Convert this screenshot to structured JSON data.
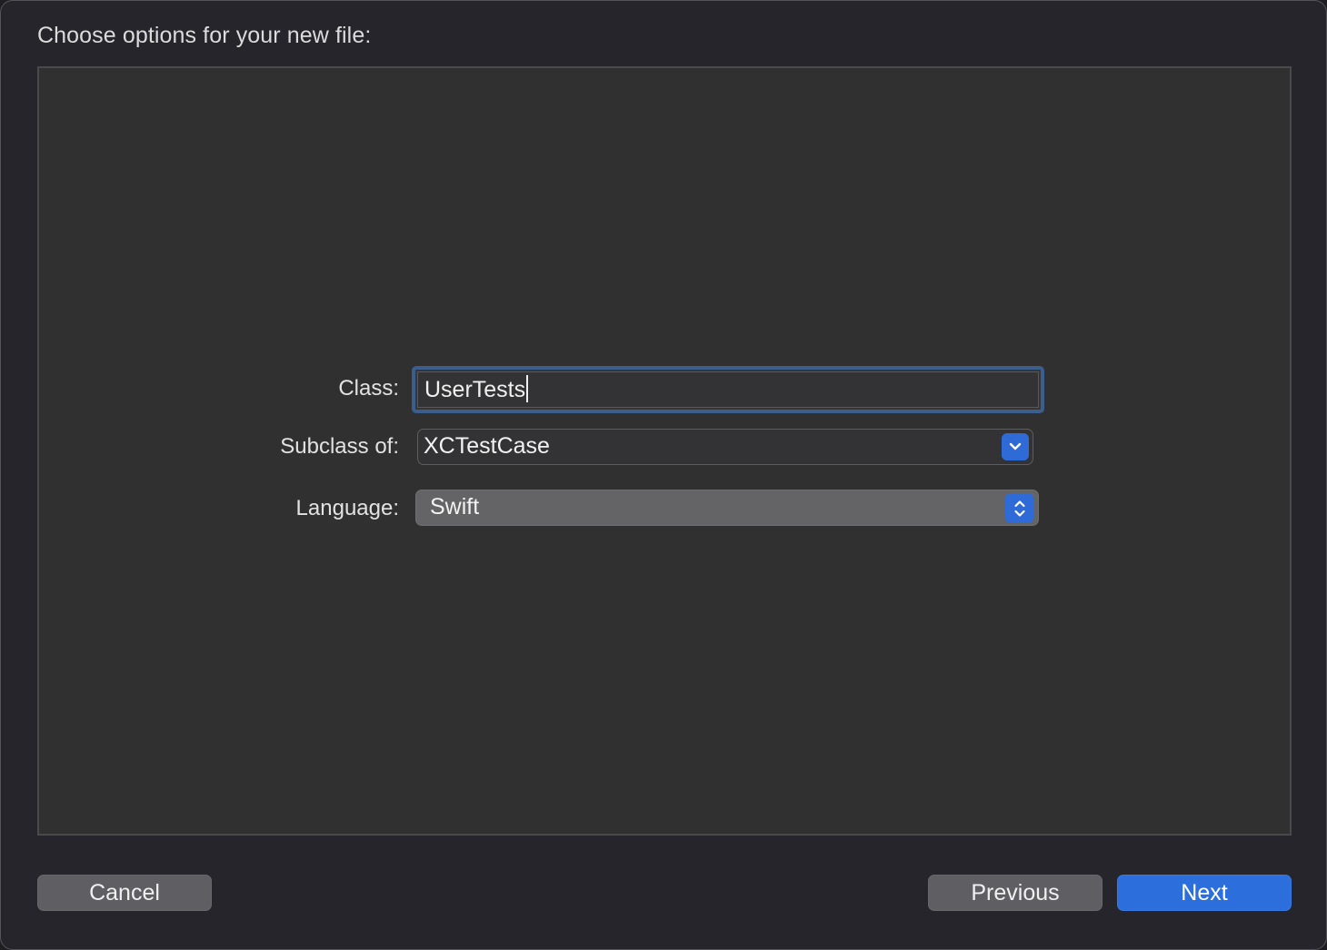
{
  "dialog": {
    "title": "Choose options for your new file:"
  },
  "form": {
    "class_label": "Class:",
    "class_value": "UserTests",
    "subclass_label": "Subclass of:",
    "subclass_value": "XCTestCase",
    "language_label": "Language:",
    "language_value": "Swift"
  },
  "buttons": {
    "cancel": "Cancel",
    "previous": "Previous",
    "next": "Next"
  },
  "icons": {
    "subclass_popup": "chevron-down-icon",
    "language_popup": "up-down-chevron-icon"
  },
  "colors": {
    "accent": "#2c6fdc",
    "focus_ring": "#3a5f8e"
  }
}
